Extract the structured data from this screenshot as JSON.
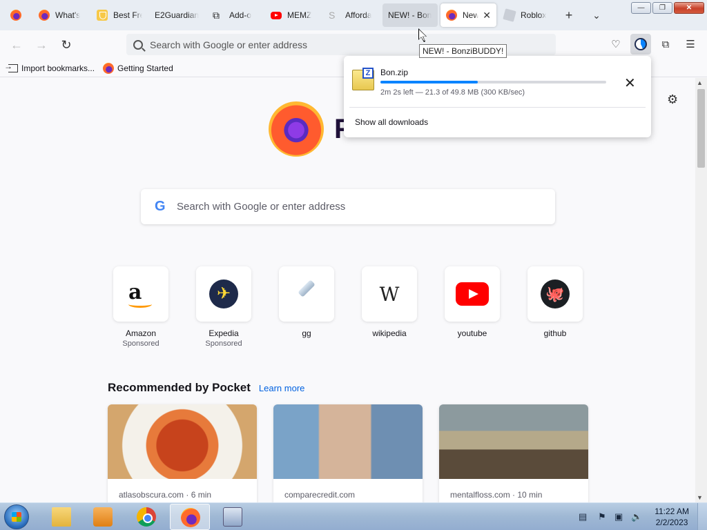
{
  "tabs": [
    {
      "label": "What's",
      "icon": "firefox-icon"
    },
    {
      "label": "Best Fre",
      "icon": "shield-icon"
    },
    {
      "label": "E2Guardian",
      "icon": "none"
    },
    {
      "label": "Add-o",
      "icon": "puzzle-icon"
    },
    {
      "label": "MEMZ",
      "icon": "youtube-icon"
    },
    {
      "label": "Afforda",
      "icon": "dollar-icon"
    },
    {
      "label": "NEW! - Bon",
      "icon": "none"
    },
    {
      "label": "New",
      "icon": "firefox-icon",
      "active": true
    },
    {
      "label": "Roblox",
      "icon": "roblox-icon"
    }
  ],
  "window_controls": {
    "minimize": "—",
    "maximize": "❐",
    "close": "✕"
  },
  "urlbar": {
    "placeholder": "Search with Google or enter address"
  },
  "bookmarks": [
    {
      "label": "Import bookmarks...",
      "icon": "import-icon"
    },
    {
      "label": "Getting Started",
      "icon": "firefox-icon"
    }
  ],
  "tooltip": "NEW! - BonziBUDDY!",
  "download": {
    "filename": "Bon.zip",
    "progress": 0.43,
    "status": "2m 2s left — 21.3 of 49.8 MB (300 KB/sec)",
    "show_all": "Show all downloads",
    "badge": "Z"
  },
  "home": {
    "logo_text": "F",
    "search_placeholder": "Search with Google or enter address",
    "google_letter": "G"
  },
  "shortcuts": [
    {
      "title": "Amazon",
      "sub": "Sponsored",
      "icon": "amazon-icon"
    },
    {
      "title": "Expedia",
      "sub": "Sponsored",
      "icon": "expedia-icon"
    },
    {
      "title": "gg",
      "sub": "",
      "icon": "pin-icon"
    },
    {
      "title": "wikipedia",
      "sub": "",
      "icon": "wikipedia-icon"
    },
    {
      "title": "youtube",
      "sub": "",
      "icon": "youtube-icon"
    },
    {
      "title": "github",
      "sub": "",
      "icon": "github-icon"
    }
  ],
  "pocket": {
    "title": "Recommended by Pocket",
    "learn_more": "Learn more",
    "cards": [
      {
        "source": "atlasobscura.com · 6 min"
      },
      {
        "source": "comparecredit.com"
      },
      {
        "source": "mentalfloss.com · 10 min"
      }
    ]
  },
  "taskbar": {
    "time": "11:22 AM",
    "date": "2/2/2023"
  }
}
